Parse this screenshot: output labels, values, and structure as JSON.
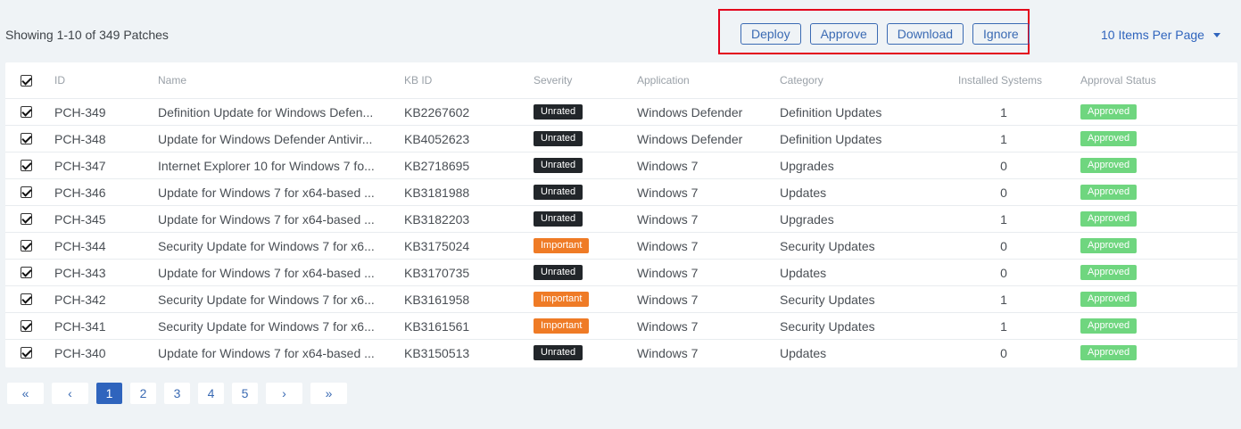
{
  "summary": "Showing 1-10 of 349 Patches",
  "actions": {
    "deploy": "Deploy",
    "approve": "Approve",
    "download": "Download",
    "ignore": "Ignore"
  },
  "per_page": "10 Items Per Page",
  "header_checked": true,
  "columns": {
    "id": "ID",
    "name": "Name",
    "kb": "KB ID",
    "severity": "Severity",
    "application": "Application",
    "category": "Category",
    "installed": "Installed Systems",
    "approval": "Approval Status"
  },
  "rows": [
    {
      "id": "PCH-349",
      "name": "Definition Update for Windows Defen...",
      "kb": "KB2267602",
      "severity": "Unrated",
      "application": "Windows Defender",
      "category": "Definition Updates",
      "installed": "1",
      "approval": "Approved"
    },
    {
      "id": "PCH-348",
      "name": "Update for Windows Defender Antivir...",
      "kb": "KB4052623",
      "severity": "Unrated",
      "application": "Windows Defender",
      "category": "Definition Updates",
      "installed": "1",
      "approval": "Approved"
    },
    {
      "id": "PCH-347",
      "name": "Internet Explorer 10 for Windows 7 fo...",
      "kb": "KB2718695",
      "severity": "Unrated",
      "application": "Windows 7",
      "category": "Upgrades",
      "installed": "0",
      "approval": "Approved"
    },
    {
      "id": "PCH-346",
      "name": "Update for Windows 7 for x64-based ...",
      "kb": "KB3181988",
      "severity": "Unrated",
      "application": "Windows 7",
      "category": "Updates",
      "installed": "0",
      "approval": "Approved"
    },
    {
      "id": "PCH-345",
      "name": "Update for Windows 7 for x64-based ...",
      "kb": "KB3182203",
      "severity": "Unrated",
      "application": "Windows 7",
      "category": "Upgrades",
      "installed": "1",
      "approval": "Approved"
    },
    {
      "id": "PCH-344",
      "name": "Security Update for Windows 7 for x6...",
      "kb": "KB3175024",
      "severity": "Important",
      "application": "Windows 7",
      "category": "Security Updates",
      "installed": "0",
      "approval": "Approved"
    },
    {
      "id": "PCH-343",
      "name": "Update for Windows 7 for x64-based ...",
      "kb": "KB3170735",
      "severity": "Unrated",
      "application": "Windows 7",
      "category": "Updates",
      "installed": "0",
      "approval": "Approved"
    },
    {
      "id": "PCH-342",
      "name": "Security Update for Windows 7 for x6...",
      "kb": "KB3161958",
      "severity": "Important",
      "application": "Windows 7",
      "category": "Security Updates",
      "installed": "1",
      "approval": "Approved"
    },
    {
      "id": "PCH-341",
      "name": "Security Update for Windows 7 for x6...",
      "kb": "KB3161561",
      "severity": "Important",
      "application": "Windows 7",
      "category": "Security Updates",
      "installed": "1",
      "approval": "Approved"
    },
    {
      "id": "PCH-340",
      "name": "Update for Windows 7 for x64-based ...",
      "kb": "KB3150513",
      "severity": "Unrated",
      "application": "Windows 7",
      "category": "Updates",
      "installed": "0",
      "approval": "Approved"
    }
  ],
  "pager": {
    "first": "«",
    "prev": "‹",
    "pages": [
      "1",
      "2",
      "3",
      "4",
      "5"
    ],
    "active": "1",
    "next": "›",
    "last": "»"
  },
  "colors": {
    "highlight_box": "#e3001b",
    "link": "#2f64bd",
    "unrated": "#22262a",
    "important": "#ef7b26",
    "approved": "#6fd67f"
  }
}
